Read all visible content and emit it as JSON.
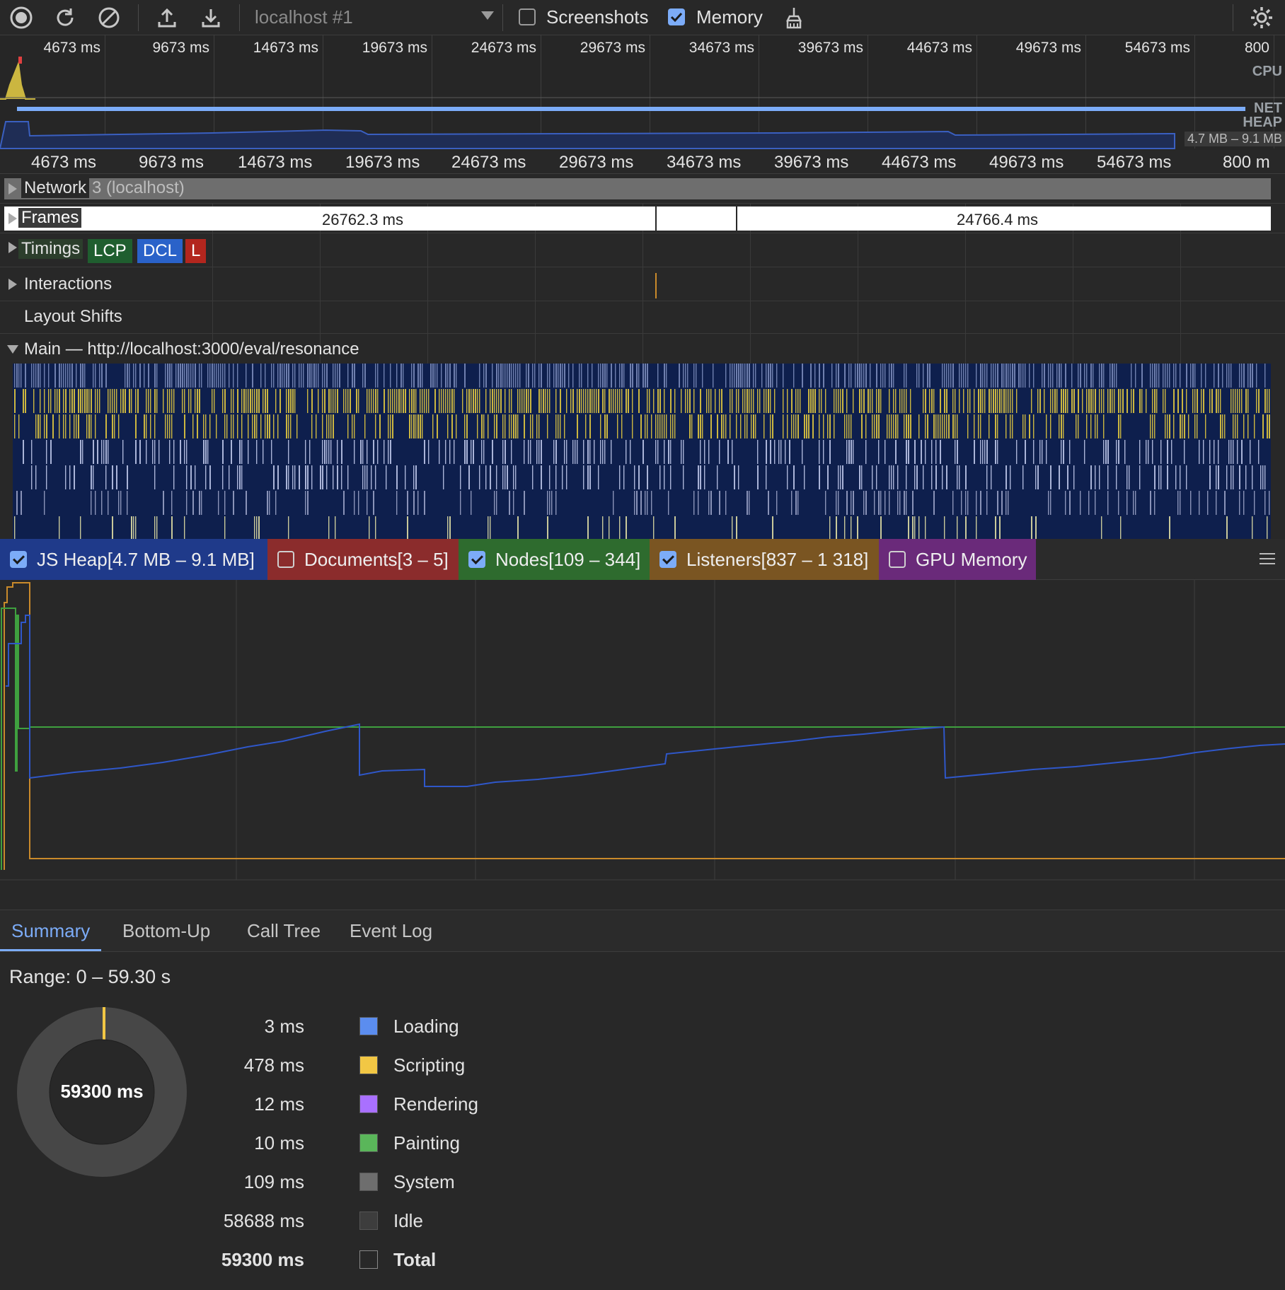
{
  "toolbar": {
    "target": "localhost #1",
    "screenshots_label": "Screenshots",
    "screenshots_checked": false,
    "memory_label": "Memory",
    "memory_checked": true
  },
  "overview": {
    "ticks": [
      "4673 ms",
      "9673 ms",
      "14673 ms",
      "19673 ms",
      "24673 ms",
      "29673 ms",
      "34673 ms",
      "39673 ms",
      "44673 ms",
      "49673 ms",
      "54673 ms",
      "800"
    ],
    "cpu_label": "CPU",
    "net_label": "NET",
    "heap_label": "HEAP",
    "heap_range": "4.7 MB – 9.1 MB"
  },
  "ruler": {
    "ticks": [
      "4673 ms",
      "9673 ms",
      "14673 ms",
      "19673 ms",
      "24673 ms",
      "29673 ms",
      "34673 ms",
      "39673 ms",
      "44673 ms",
      "49673 ms",
      "54673 ms",
      "800 m"
    ]
  },
  "tracks": {
    "network_label": "Network",
    "network_suffix": "3 (localhost)",
    "frames_label": "Frames",
    "frame_1": "26762.3 ms",
    "frame_2": "24766.4 ms",
    "timings_label": "Timings",
    "lcp": "LCP",
    "dcl": "DCL",
    "l": "L",
    "interactions_label": "Interactions",
    "layout_shifts_label": "Layout Shifts",
    "main_label": "Main — http://localhost:3000/eval/resonance"
  },
  "counters": [
    {
      "label": "JS Heap[4.7 MB – 9.1 MB]",
      "checked": true,
      "color": "#1f3a8a"
    },
    {
      "label": "Documents[3 – 5]",
      "checked": false,
      "color": "#8b2c2c"
    },
    {
      "label": "Nodes[109 – 344]",
      "checked": true,
      "color": "#2e6b2e"
    },
    {
      "label": "Listeners[837 – 1 318]",
      "checked": true,
      "color": "#7a5522"
    },
    {
      "label": "GPU Memory",
      "checked": false,
      "color": "#6a2a7a"
    }
  ],
  "tabs": [
    "Summary",
    "Bottom-Up",
    "Call Tree",
    "Event Log"
  ],
  "summary": {
    "range": "Range: 0 – 59.30 s",
    "total_center": "59300 ms",
    "rows": [
      {
        "value": "3 ms",
        "category": "Loading",
        "color": "#5b8def"
      },
      {
        "value": "478 ms",
        "category": "Scripting",
        "color": "#f2c744"
      },
      {
        "value": "12 ms",
        "category": "Rendering",
        "color": "#a970ff"
      },
      {
        "value": "10 ms",
        "category": "Painting",
        "color": "#5ab65a"
      },
      {
        "value": "109 ms",
        "category": "System",
        "color": "#6e6e6e"
      },
      {
        "value": "58688 ms",
        "category": "Idle",
        "color": "#3d3d3d"
      },
      {
        "value": "59300 ms",
        "category": "Total",
        "color": "#282828"
      }
    ]
  },
  "colors": {
    "accent": "#7cacf8",
    "heap_line": "#2f57c9",
    "nodes_line": "#3fa03f",
    "listeners_line": "#c98a2b",
    "flame_dark": "#0e1f4d",
    "flame_yellow": "#cbb640"
  }
}
